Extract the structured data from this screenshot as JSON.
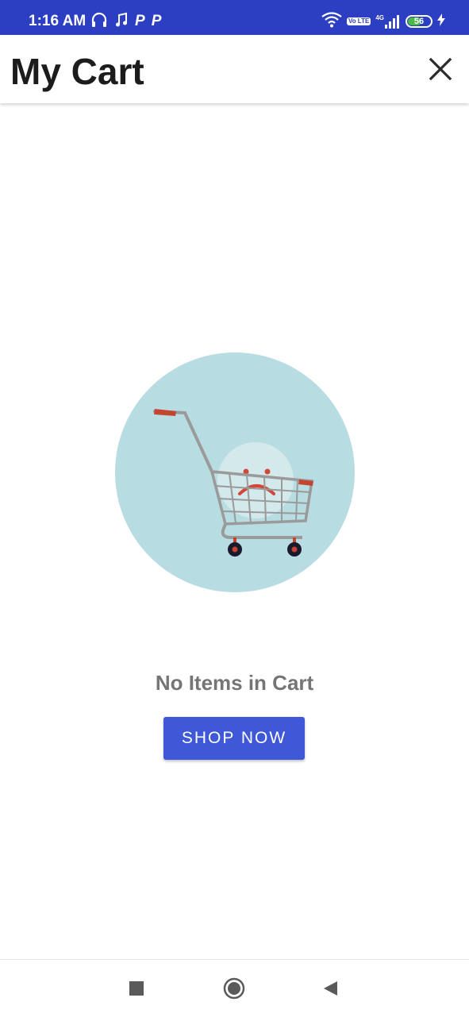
{
  "status_bar": {
    "time": "1:16 AM",
    "left_icons": [
      "headphones-icon",
      "music-icon",
      "p-app-icon",
      "p-app-icon"
    ],
    "volte_label": "Vo LTE",
    "network_label": "4G",
    "battery_level": "56",
    "battery_fraction": 0.56
  },
  "header": {
    "title": "My Cart",
    "close_icon": "close-icon"
  },
  "empty_state": {
    "illustration": "sad-shopping-cart",
    "message": "No Items in Cart",
    "button_label": "SHOP NOW"
  },
  "nav_bar": {
    "items": [
      "recents-icon",
      "home-icon",
      "back-icon"
    ]
  },
  "colors": {
    "status_bar": "#2c3fc2",
    "button": "#3f58d8",
    "illustration_circle": "#b7dce1",
    "message_text": "#757575"
  }
}
